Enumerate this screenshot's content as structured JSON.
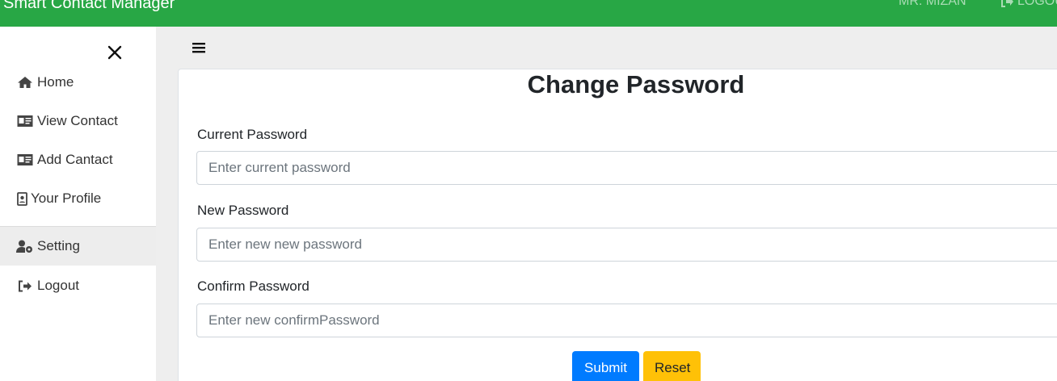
{
  "navbar": {
    "brand": "Smart Contact Manager",
    "user": "MR. MIZAN",
    "logout": "LOGOUT",
    "bg_color": "#28a745"
  },
  "sidebar": {
    "close_icon": "close-icon",
    "items": [
      {
        "label": "Home",
        "icon": "home-icon"
      },
      {
        "label": "View Contact",
        "icon": "id-card-icon"
      },
      {
        "label": "Add Cantact",
        "icon": "id-card-icon"
      },
      {
        "label": "Your Profile",
        "icon": "id-badge-icon"
      },
      {
        "label": "Setting",
        "icon": "user-cog-icon",
        "active": true
      },
      {
        "label": "Logout",
        "icon": "sign-out-icon"
      }
    ]
  },
  "main": {
    "menu_icon": "hamburger-icon",
    "title": "Change Password",
    "form": {
      "current": {
        "label": "Current Password",
        "placeholder": "Enter current password",
        "value": ""
      },
      "new": {
        "label": "New Password",
        "placeholder": "Enter new new password",
        "value": ""
      },
      "confirm": {
        "label": "Confirm Password",
        "placeholder": "Enter new confirmPassword",
        "value": ""
      }
    },
    "buttons": {
      "submit": "Submit",
      "reset": "Reset",
      "submit_color": "#007bff",
      "reset_color": "#ffc107"
    }
  }
}
